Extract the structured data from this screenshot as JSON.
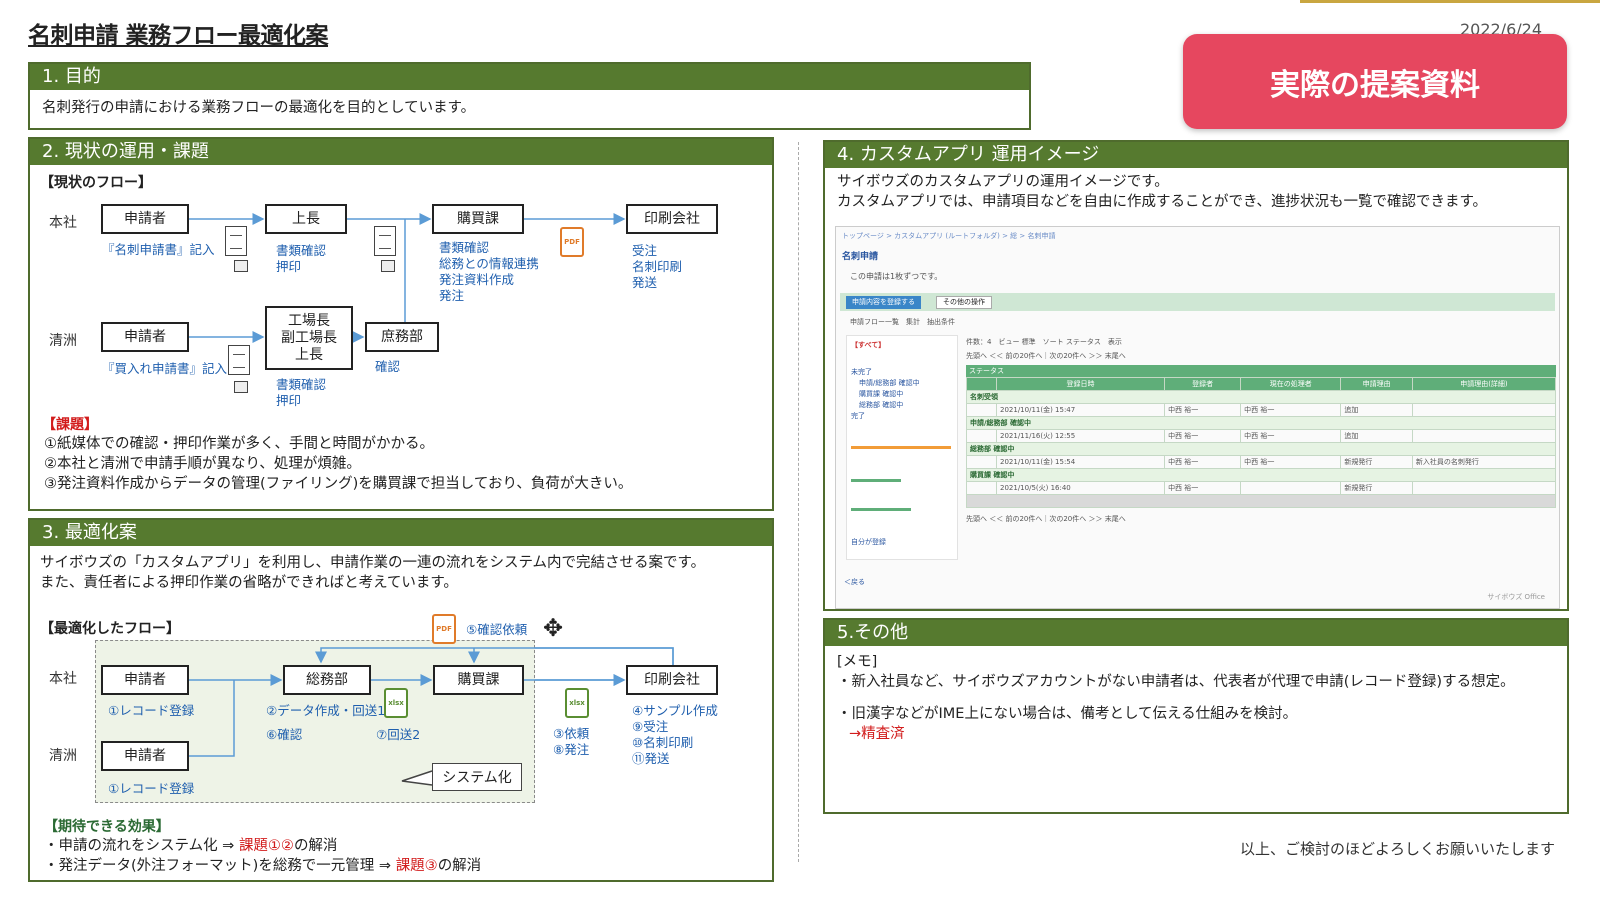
{
  "header": {
    "title": "名刺申請 業務フロー最適化案",
    "date": "2022/6/24",
    "badge": "実際の提案資料"
  },
  "s1": {
    "heading": "1. 目的",
    "text": "名刺発行の申請における業務フローの最適化を目的としています。"
  },
  "s2": {
    "heading": "2. 現状の運用・課題",
    "flow_label": "【現状のフロー】",
    "loc_honsha": "本社",
    "loc_kiyosu": "清洲",
    "box_applicant": "申請者",
    "box_boss": "上長",
    "box_purchase": "購買課",
    "box_printer": "印刷会社",
    "box_factory_l1": "工場長",
    "box_factory_l2": "副工場長",
    "box_factory_l3": "上長",
    "box_general": "庶務部",
    "note_apply1": "『名刺申請書』記入",
    "note_boss_1": "書類確認",
    "note_boss_2": "押印",
    "note_purchase_1": "書類確認",
    "note_purchase_2": "総務との情報連携",
    "note_purchase_3": "発注資料作成",
    "note_purchase_4": "発注",
    "note_printer_1": "受注",
    "note_printer_2": "名刺印刷",
    "note_printer_3": "発送",
    "note_apply2": "『買入れ申請書』記入",
    "note_factory_1": "書類確認",
    "note_factory_2": "押印",
    "note_general": "確認",
    "issues_label": "【課題】",
    "issue1": "①紙媒体での確認・押印作業が多く、手間と時間がかかる。",
    "issue2": "②本社と清洲で申請手順が異なり、処理が煩雑。",
    "issue3": "③発注資料作成からデータの管理(ファイリング)を購買課で担当しており、負荷が大きい。"
  },
  "s3": {
    "heading": "3. 最適化案",
    "text1": "サイボウズの「カスタムアプリ」を利用し、申請作業の一連の流れをシステム内で完結させる案です。",
    "text2": "また、責任者による押印作業の省略ができればと考えています。",
    "flow_label": "【最適化したフロー】",
    "loc_honsha": "本社",
    "loc_kiyosu": "清洲",
    "box_applicant": "申請者",
    "box_general_affairs": "総務部",
    "box_purchase": "購買課",
    "box_printer": "印刷会社",
    "confirm_request": "⑤確認依頼",
    "note_record1": "①レコード登録",
    "note_record2": "①レコード登録",
    "note_ga_1": "②データ作成・回送1",
    "note_ga_2": "⑥確認",
    "note_ga_3": "⑦回送2",
    "note_pu_1": "③依頼",
    "note_pu_2": "⑧発注",
    "note_pr_1": "④サンプル作成",
    "note_pr_2": "⑨受注",
    "note_pr_3": "⑩名刺印刷",
    "note_pr_4": "⑪発送",
    "system_label": "システム化",
    "effects_label": "【期待できる効果】",
    "effect1_a": "・申請の流れをシステム化 ⇒ ",
    "effect1_b": "課題①②",
    "effect1_c": "の解消",
    "effect2_a": "・発注データ(外注フォーマット)を総務で一元管理 ⇒ ",
    "effect2_b": "課題③",
    "effect2_c": "の解消"
  },
  "s4": {
    "heading": "4. カスタムアプリ 運用イメージ",
    "text1": "サイボウズのカスタムアプリの運用イメージです。",
    "text2": "カスタムアプリでは、申請項目などを自由に作成することができ、進捗状況も一覧で確認できます。",
    "app": {
      "crumb": "トップページ > カスタムアプリ (ルートフォルダ) > 総 > 名刺申請",
      "title": "名刺申請",
      "note": "この申請は1枚ずつです。",
      "btn_register": "申請内容を登録する",
      "btn_other": "その他の操作",
      "tabs": "申請フロー一覧　集計　抽出条件",
      "side_all": "【すべて】",
      "side_s1": "未完了",
      "side_s2": "申請/総務部 確認中",
      "side_s3": "購買課 確認中",
      "side_s4": "総務部 確認中",
      "side_s5": "完了",
      "side_link": "自分が登録",
      "toolbar": "件数：4　ビュー 標準　ソート ステータス　表示",
      "pager": "先頭へ ＜＜ 前の20件へ｜次の20件へ ＞＞ 末尾へ",
      "status_col": "ステータス",
      "cols": [
        "",
        "登録日時",
        "登録者",
        "現在の処理者",
        "申請理由",
        "申請理由(詳細)"
      ],
      "groups": [
        {
          "name": "名刺受領",
          "row": [
            "",
            "2021/10/11(金) 15:47",
            "中西 裕一",
            "中西 裕一",
            "追加",
            ""
          ]
        },
        {
          "name": "申請/総務部 確認中",
          "row": [
            "",
            "2021/11/16(火) 12:55",
            "中西 裕一",
            "中西 裕一",
            "追加",
            ""
          ]
        },
        {
          "name": "総務部 確認中",
          "row": [
            "",
            "2021/10/11(金) 15:54",
            "中西 裕一",
            "中西 裕一",
            "新規発行",
            "新入社員の名刺発行"
          ]
        },
        {
          "name": "購買課 確認中",
          "row": [
            "",
            "2021/10/5(火) 16:40",
            "中西 裕一",
            "",
            "新規発行",
            ""
          ]
        }
      ],
      "footer": "サイボウズ Office",
      "back": "＜戻る"
    }
  },
  "s5": {
    "heading": "5.その他",
    "memo": "[メモ]",
    "line1": "・新入社員など、サイボウズアカウントがない申請者は、代表者が代理で申請(レコード登録)する想定。",
    "line2": "・旧漢字などがIME上にない場合は、備考として伝える仕組みを検討。",
    "line3": "→精査済"
  },
  "closing": "以上、ご検討のほどよろしくお願いいたします"
}
